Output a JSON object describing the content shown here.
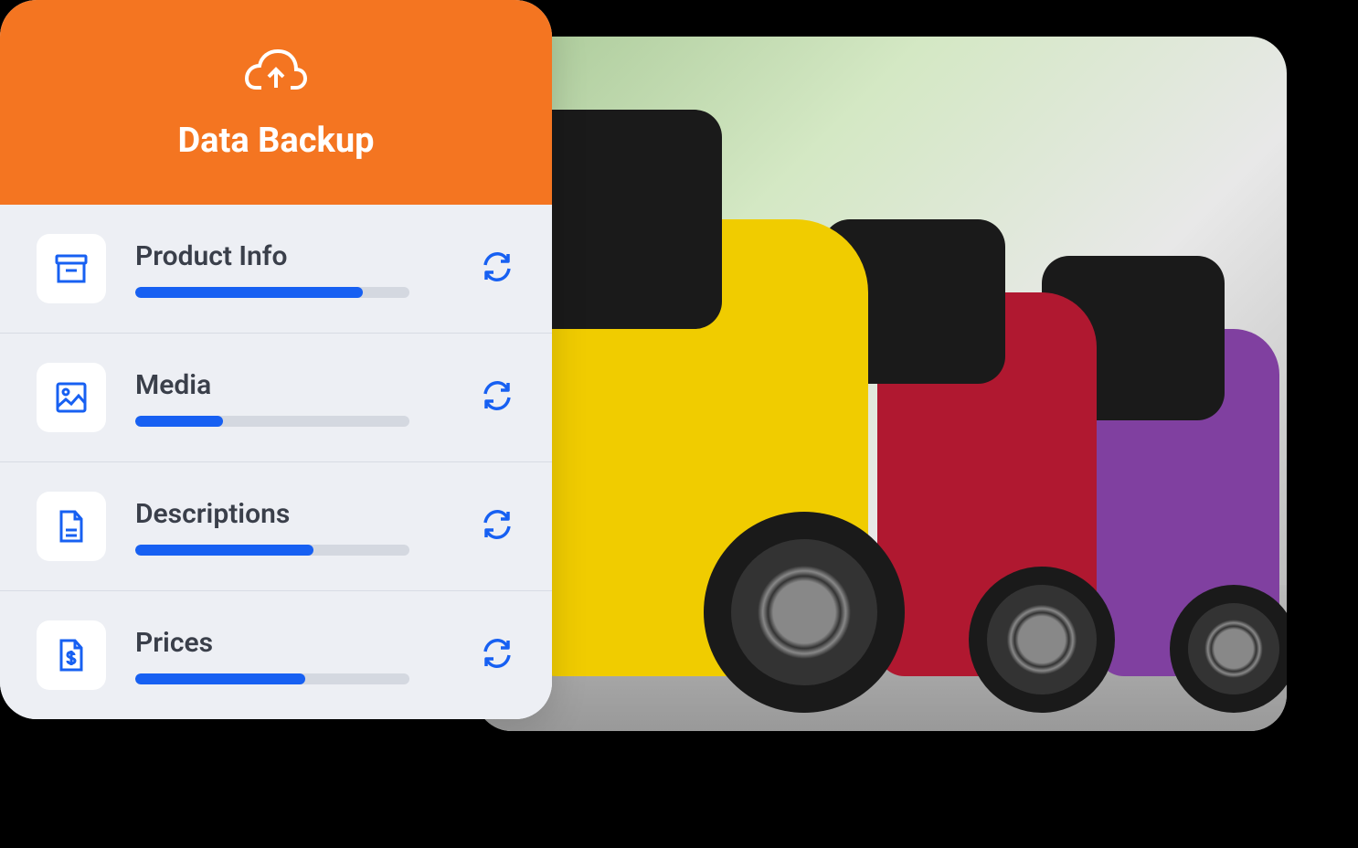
{
  "header": {
    "title": "Data Backup"
  },
  "colors": {
    "primary": "#1760f2",
    "accent": "#f47521"
  },
  "items": [
    {
      "label": "Product Info",
      "progress": 83,
      "icon": "archive-box"
    },
    {
      "label": "Media",
      "progress": 32,
      "icon": "image"
    },
    {
      "label": "Descriptions",
      "progress": 65,
      "icon": "file-text"
    },
    {
      "label": "Prices",
      "progress": 62,
      "icon": "file-dollar"
    }
  ]
}
